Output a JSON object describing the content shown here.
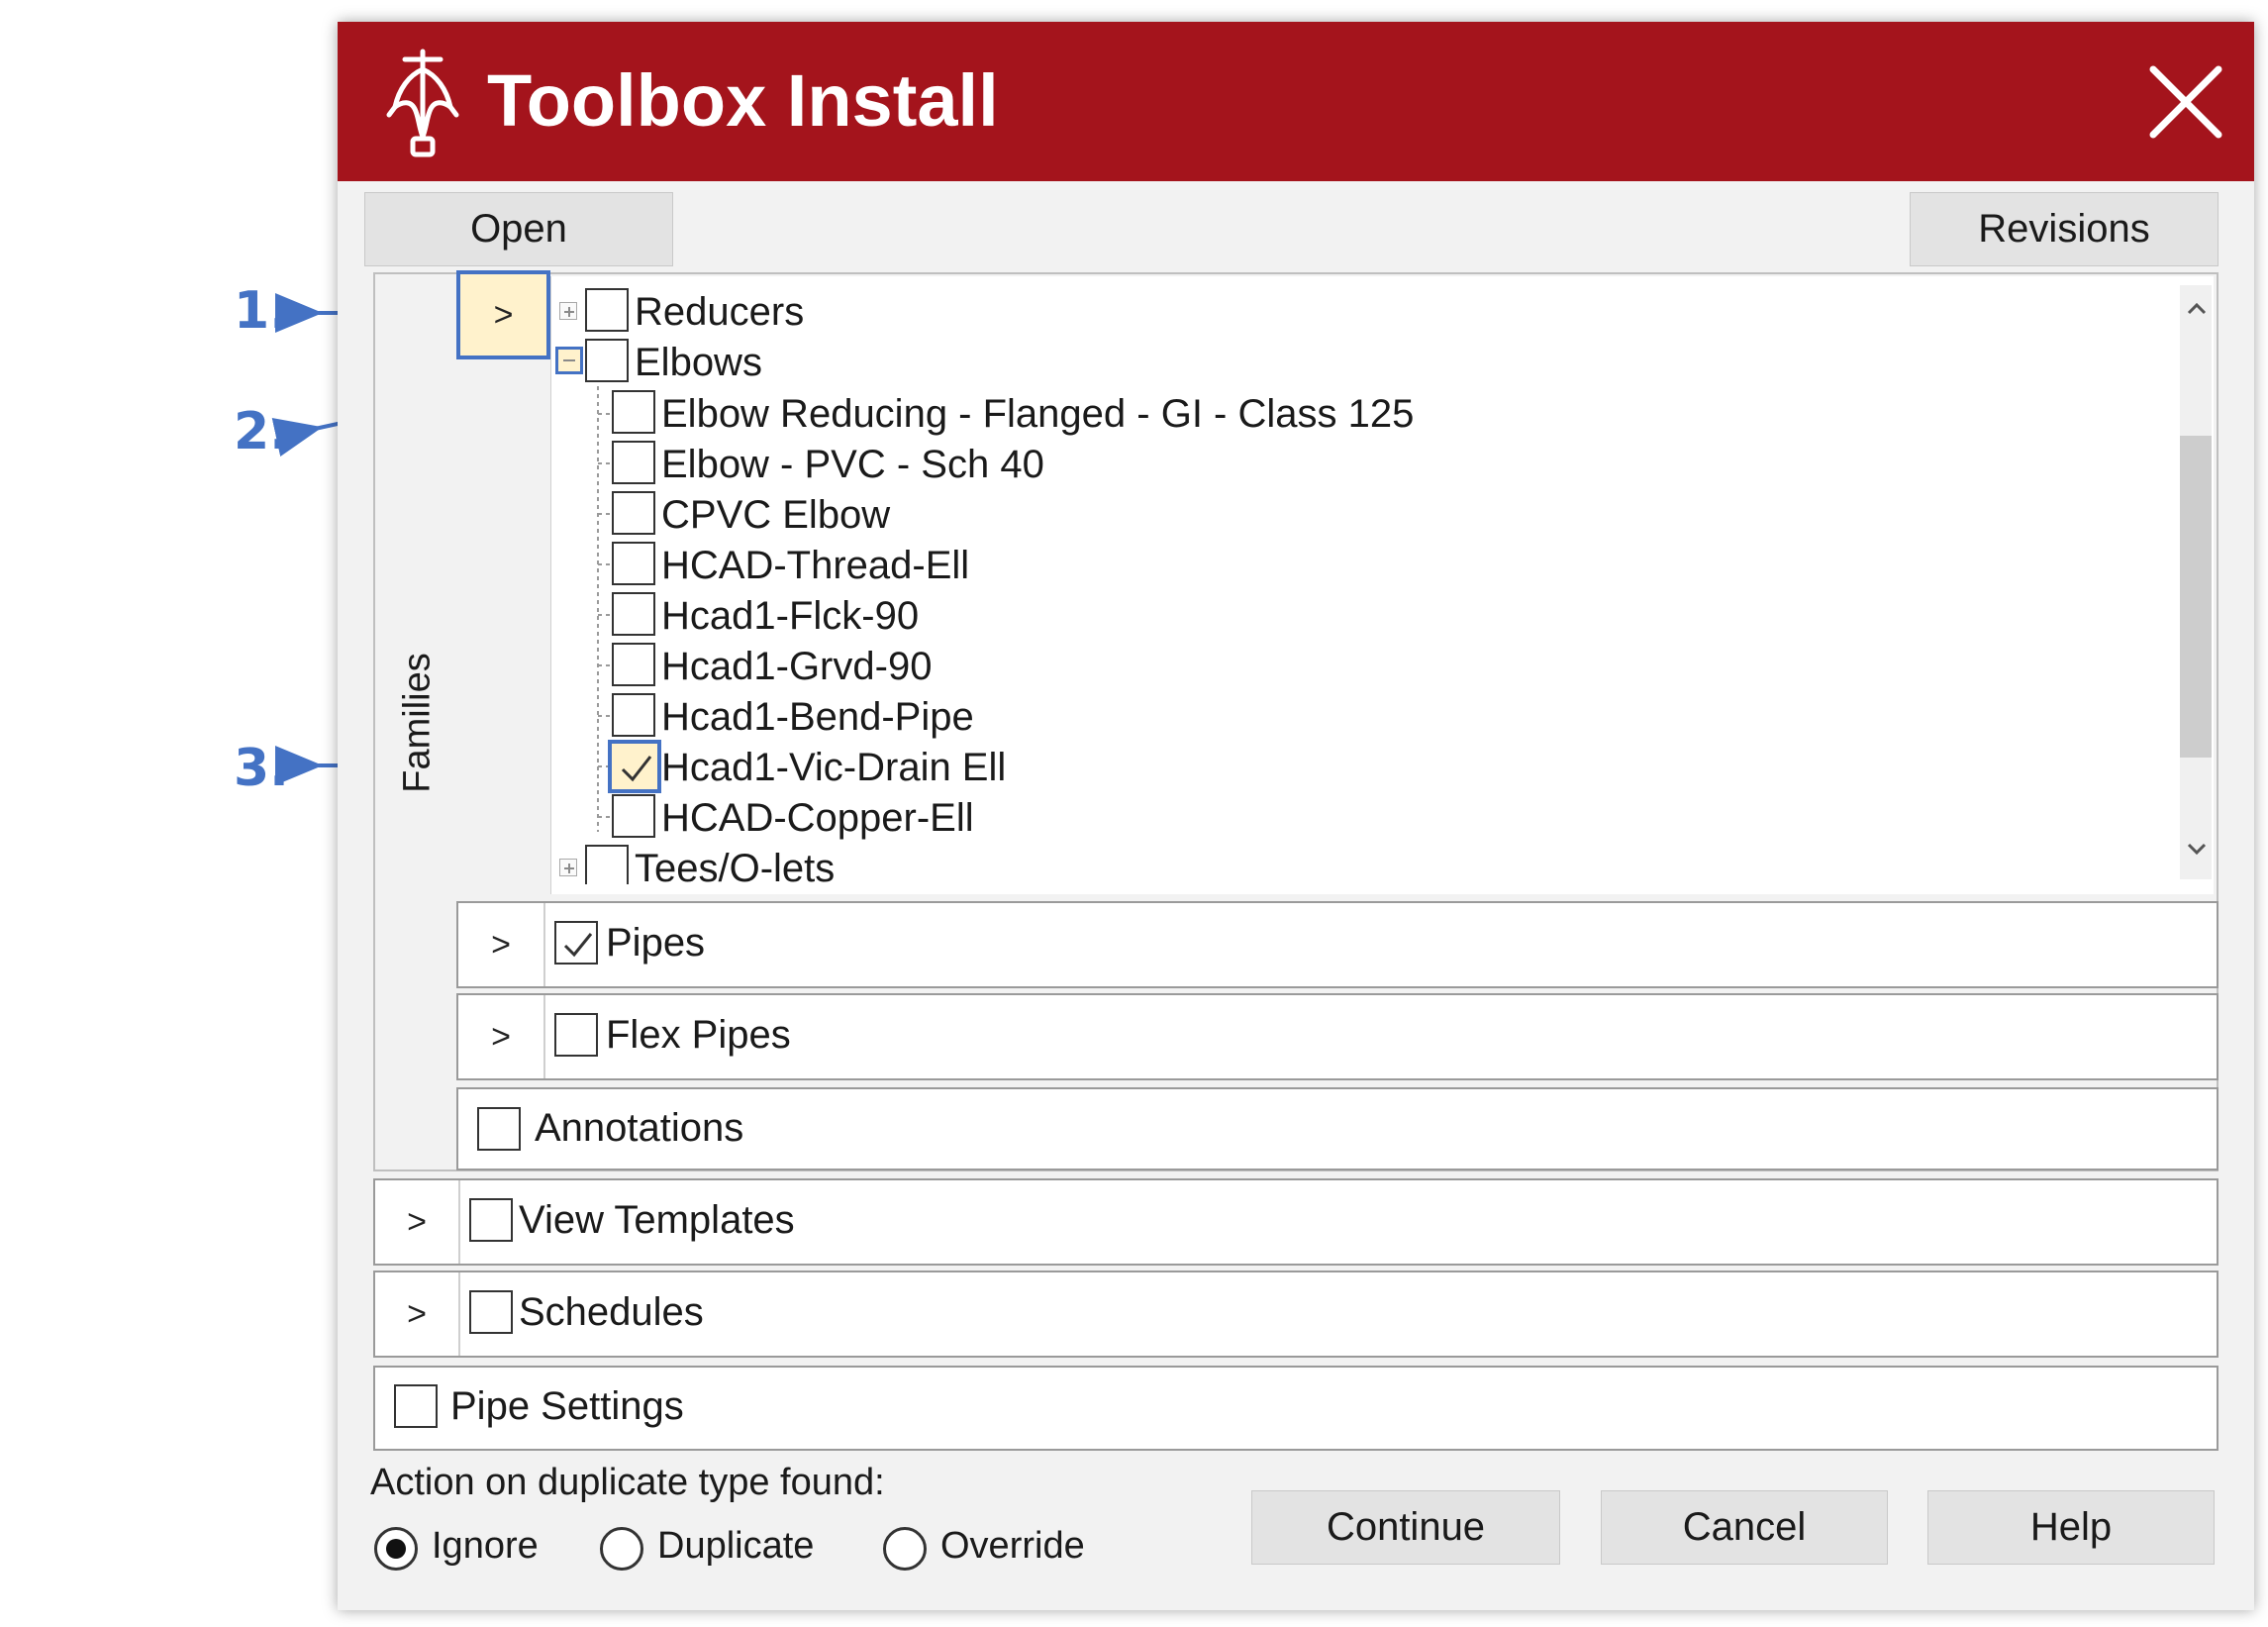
{
  "window": {
    "title": "Toolbox Install",
    "logo_icon": "mermaid-logo-icon",
    "close_icon": "close-x-icon",
    "titlebar_color": "#a4141c"
  },
  "toolbar": {
    "open_label": "Open",
    "revisions_label": "Revisions"
  },
  "families": {
    "label": "Families",
    "toggle_symbol": ">",
    "tree": [
      {
        "label": "Reducers",
        "checked": false,
        "expanded": false
      },
      {
        "label": "Elbows",
        "checked": false,
        "expanded": true,
        "children": [
          {
            "label": "Elbow Reducing - Flanged - GI - Class 125",
            "checked": false
          },
          {
            "label": "Elbow - PVC - Sch 40",
            "checked": false
          },
          {
            "label": "CPVC Elbow",
            "checked": false
          },
          {
            "label": "HCAD-Thread-Ell",
            "checked": false
          },
          {
            "label": "Hcad1-Flck-90",
            "checked": false
          },
          {
            "label": "Hcad1-Grvd-90",
            "checked": false
          },
          {
            "label": "Hcad1-Bend-Pipe",
            "checked": false
          },
          {
            "label": "Hcad1-Vic-Drain Ell",
            "checked": true
          },
          {
            "label": "HCAD-Copper-Ell",
            "checked": false
          }
        ]
      },
      {
        "label": "Tees/O-lets",
        "checked": false,
        "expanded": false
      }
    ],
    "sub_sections": [
      {
        "label": "Pipes",
        "checked": true,
        "toggle": ">"
      },
      {
        "label": "Flex Pipes",
        "checked": false,
        "toggle": ">"
      },
      {
        "label": "Annotations",
        "checked": false
      }
    ]
  },
  "sections": [
    {
      "label": "View Templates",
      "checked": false,
      "toggle": ">"
    },
    {
      "label": "Schedules",
      "checked": false,
      "toggle": ">"
    },
    {
      "label": "Pipe Settings",
      "checked": false
    }
  ],
  "footer": {
    "duplicate_label": "Action on duplicate type found:",
    "options": [
      {
        "label": "Ignore",
        "selected": true
      },
      {
        "label": "Duplicate",
        "selected": false
      },
      {
        "label": "Override",
        "selected": false
      }
    ],
    "continue_label": "Continue",
    "cancel_label": "Cancel",
    "help_label": "Help"
  },
  "callouts": [
    "1.",
    "2.",
    "3."
  ],
  "colors": {
    "callout": "#4472c4",
    "highlight": "#fff2cc"
  }
}
